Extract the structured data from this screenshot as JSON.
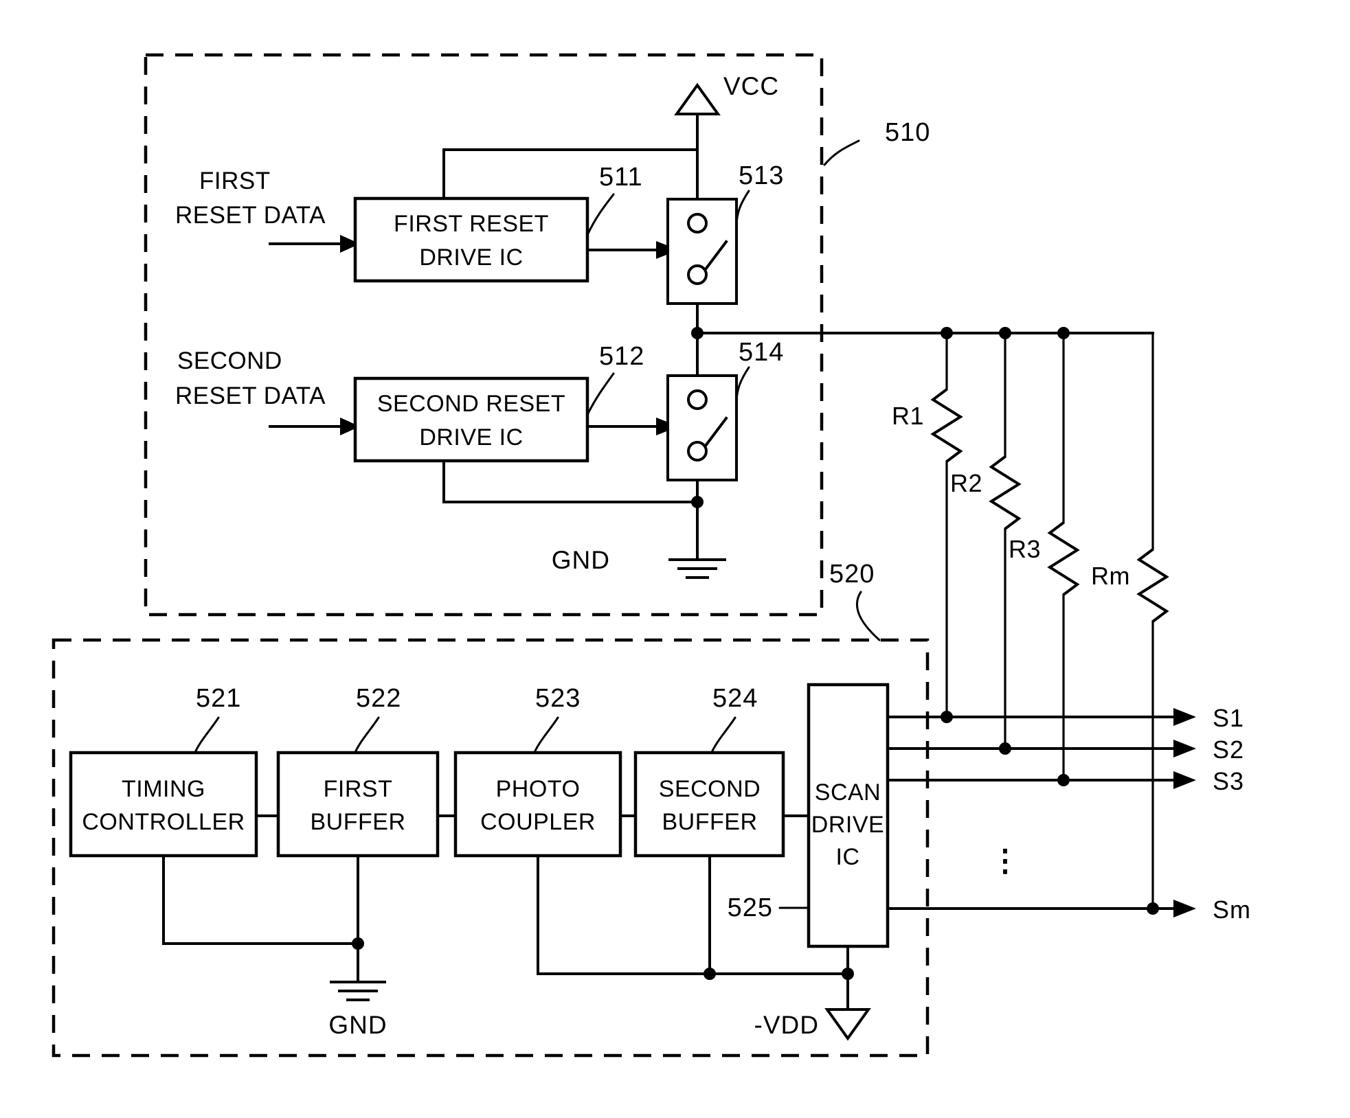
{
  "figure": {
    "kind": "circuit-block-diagram",
    "background": "#ffffff",
    "ink": "#000000"
  },
  "groups": [
    {
      "id": "reset_section",
      "ref": "510"
    },
    {
      "id": "scan_section",
      "ref": "520"
    }
  ],
  "reset_section": {
    "ref": "510",
    "inputs": [
      {
        "id": "first_reset_data",
        "line1": "FIRST",
        "line2": "RESET DATA"
      },
      {
        "id": "second_reset_data",
        "line1": "SECOND",
        "line2": "RESET DATA"
      }
    ],
    "blocks": [
      {
        "id": "first_reset_drive_ic",
        "ref": "511",
        "line1": "FIRST RESET",
        "line2": "DRIVE IC"
      },
      {
        "id": "second_reset_drive_ic",
        "ref": "512",
        "line1": "SECOND RESET",
        "line2": "DRIVE IC"
      }
    ],
    "switches": [
      {
        "id": "first_switch",
        "ref": "513"
      },
      {
        "id": "second_switch",
        "ref": "514"
      }
    ],
    "rails": [
      {
        "id": "vcc",
        "label": "VCC",
        "symbol": "supply-triangle"
      },
      {
        "id": "gnd",
        "label": "GND",
        "symbol": "ground"
      }
    ]
  },
  "scan_section": {
    "ref": "520",
    "blocks": [
      {
        "id": "timing_controller",
        "ref": "521",
        "line1": "TIMING",
        "line2": "CONTROLLER"
      },
      {
        "id": "first_buffer",
        "ref": "522",
        "line1": "FIRST",
        "line2": "BUFFER"
      },
      {
        "id": "photo_coupler",
        "ref": "523",
        "line1": "PHOTO",
        "line2": "COUPLER"
      },
      {
        "id": "second_buffer",
        "ref": "524",
        "line1": "SECOND",
        "line2": "BUFFER"
      },
      {
        "id": "scan_drive_ic",
        "ref": "525",
        "line1": "SCAN",
        "line2": "DRIVE",
        "line3": "IC"
      }
    ],
    "rails": [
      {
        "id": "gnd_bottom",
        "label": "GND",
        "symbol": "ground"
      },
      {
        "id": "neg_vdd",
        "label": "-VDD",
        "symbol": "supply-triangle-down"
      }
    ]
  },
  "resistors": [
    {
      "id": "r1",
      "label": "R1"
    },
    {
      "id": "r2",
      "label": "R2"
    },
    {
      "id": "r3",
      "label": "R3"
    },
    {
      "id": "rm",
      "label": "Rm"
    }
  ],
  "outputs": [
    {
      "id": "s1",
      "label": "S1"
    },
    {
      "id": "s2",
      "label": "S2"
    },
    {
      "id": "s3",
      "label": "S3"
    },
    {
      "id": "ellipsis",
      "label": "⋮"
    },
    {
      "id": "sm",
      "label": "Sm"
    }
  ],
  "chart_data": {
    "type": "diagram",
    "title": "",
    "nodes": [
      "FIRST RESET DRIVE IC (511)",
      "SECOND RESET DRIVE IC (512)",
      "first switch (513)",
      "second switch (514)",
      "TIMING CONTROLLER (521)",
      "FIRST BUFFER (522)",
      "PHOTO COUPLER (523)",
      "SECOND BUFFER (524)",
      "SCAN DRIVE IC (525)",
      "R1",
      "R2",
      "R3",
      "Rm"
    ],
    "edges": [
      [
        "FIRST RESET DATA",
        "FIRST RESET DRIVE IC (511)"
      ],
      [
        "FIRST RESET DRIVE IC (511)",
        "first switch (513)"
      ],
      [
        "VCC",
        "first switch (513)"
      ],
      [
        "SECOND RESET DATA",
        "SECOND RESET DRIVE IC (512)"
      ],
      [
        "SECOND RESET DRIVE IC (512)",
        "second switch (514)"
      ],
      [
        "second switch (514)",
        "GND"
      ],
      [
        "first switch (513)",
        "scan bus"
      ],
      [
        "TIMING CONTROLLER (521)",
        "FIRST BUFFER (522)"
      ],
      [
        "FIRST BUFFER (522)",
        "PHOTO COUPLER (523)"
      ],
      [
        "PHOTO COUPLER (523)",
        "SECOND BUFFER (524)"
      ],
      [
        "SECOND BUFFER (524)",
        "SCAN DRIVE IC (525)"
      ],
      [
        "SCAN DRIVE IC (525)",
        "S1"
      ],
      [
        "SCAN DRIVE IC (525)",
        "S2"
      ],
      [
        "SCAN DRIVE IC (525)",
        "S3"
      ],
      [
        "SCAN DRIVE IC (525)",
        "Sm"
      ],
      [
        "scan bus",
        "R1"
      ],
      [
        "scan bus",
        "R2"
      ],
      [
        "scan bus",
        "R3"
      ],
      [
        "scan bus",
        "Rm"
      ],
      [
        "R1",
        "S1"
      ],
      [
        "R2",
        "S2"
      ],
      [
        "R3",
        "S3"
      ],
      [
        "Rm",
        "Sm"
      ]
    ]
  }
}
